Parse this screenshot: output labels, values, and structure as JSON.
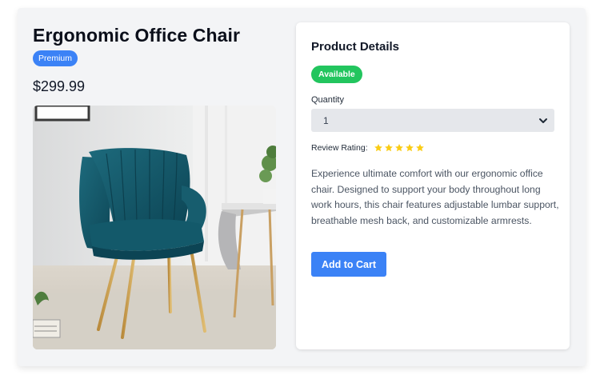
{
  "product": {
    "title": "Ergonomic Office Chair",
    "badge": "Premium",
    "price": "$299.99",
    "image_icon": "chair-photo"
  },
  "details": {
    "heading": "Product Details",
    "availability": "Available",
    "quantity_label": "Quantity",
    "quantity_value": "1",
    "rating_label": "Review Rating:",
    "rating_value": 5,
    "rating_max": 5,
    "description": "Experience ultimate comfort with our ergonomic office chair. Designed to support your body throughout long work hours, this chair features adjustable lumbar support, breathable mesh back, and customizable armrests.",
    "add_to_cart_label": "Add to Cart"
  },
  "colors": {
    "accent": "#3b82f6",
    "available": "#22c55e",
    "star": "#facc15"
  }
}
